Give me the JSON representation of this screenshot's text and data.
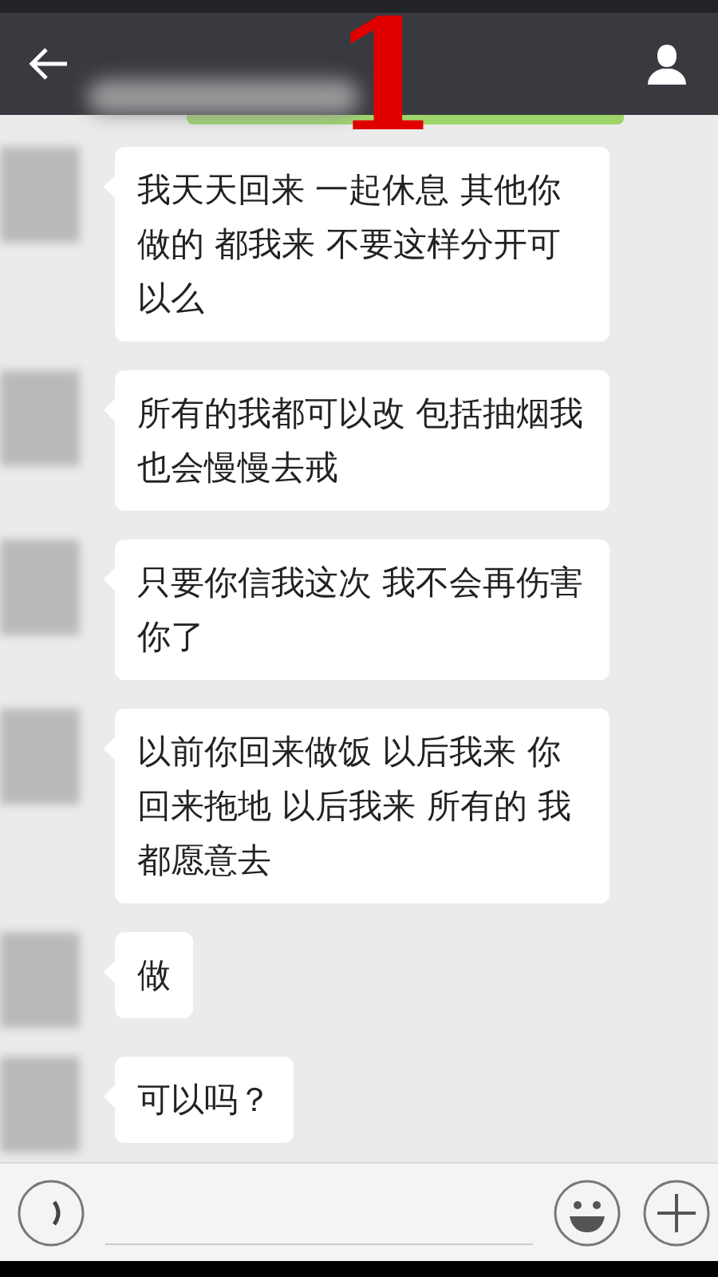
{
  "overlay_label": "1",
  "messages": [
    {
      "text": "我天天回来 一起休息 其他你做的 都我来 不要这样分开可以么"
    },
    {
      "text": "所有的我都可以改  包括抽烟我也会慢慢去戒"
    },
    {
      "text": "只要你信我这次 我不会再伤害你了"
    },
    {
      "text": "以前你回来做饭 以后我来 你回来拖地 以后我来 所有的 我都愿意去"
    },
    {
      "text": "做"
    },
    {
      "text": "可以吗？"
    }
  ]
}
